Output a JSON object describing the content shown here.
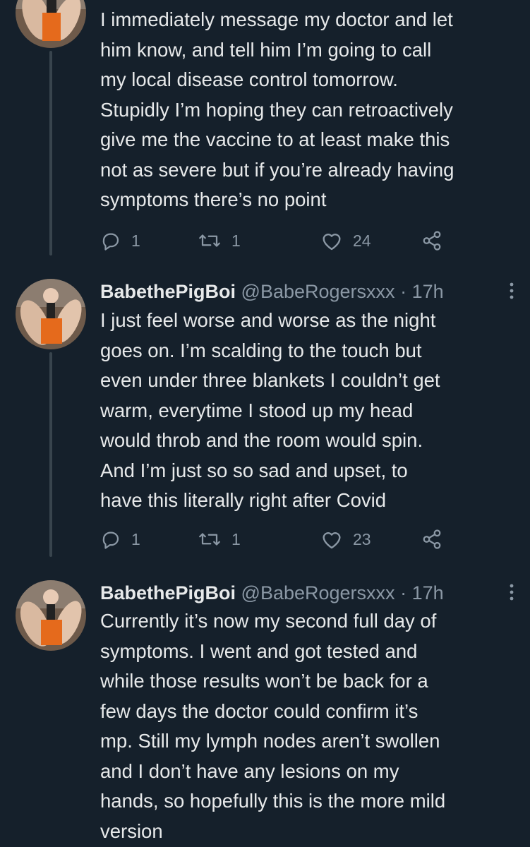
{
  "tweets": [
    {
      "text": "I immediately message my doctor and let\nhim know, and tell him I’m going to call\nmy local disease control tomorrow.\nStupidly I’m hoping they can retroactively\ngive me the vaccine to at least make this\nnot as severe but if you’re already having\nsymptoms there’s no point",
      "reply_count": "1",
      "retweet_count": "1",
      "like_count": "24"
    },
    {
      "display_name": "BabethePigBoi",
      "handle": "@BabeRogersxxx",
      "time": "· 17h",
      "text": "I just feel worse and worse as the night\ngoes on. I’m scalding to the touch but\neven under three blankets I couldn’t get\nwarm, everytime I stood up my head\nwould throb and the room would spin.\nAnd I’m just so so sad and upset, to\nhave this literally right after Covid",
      "reply_count": "1",
      "retweet_count": "1",
      "like_count": "23"
    },
    {
      "display_name": "BabethePigBoi",
      "handle": "@BabeRogersxxx",
      "time": "· 17h",
      "text": "Currently it’s now my second full day of\nsymptoms. I went and got tested and\nwhile those results won’t be back for a\nfew days the doctor could confirm it’s\nmp. Still my lymph nodes aren’t swollen\nand I don’t have any lesions on my\nhands, so hopefully this is the more mild\nversion"
    }
  ],
  "icons": {
    "reply": "speech-bubble-icon",
    "retweet": "retweet-arrows-icon",
    "like": "heart-outline-icon",
    "share": "share-nodes-icon",
    "more": "vertical-ellipsis-icon"
  },
  "colors": {
    "background": "#15202b",
    "text": "#e7e9ea",
    "secondary": "#8b98a5",
    "thread_line": "#38444d"
  }
}
